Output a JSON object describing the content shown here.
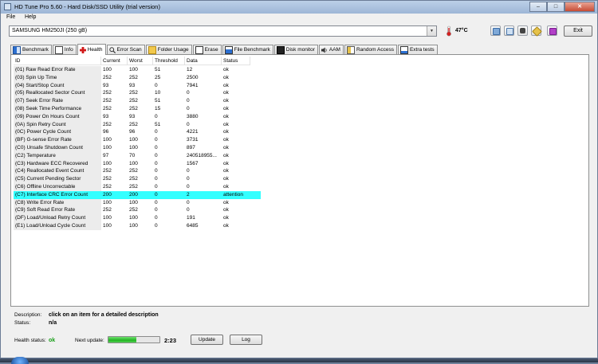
{
  "window": {
    "title": "HD Tune Pro 5.60 - Hard Disk/SSD Utility (trial version)"
  },
  "window_controls": {
    "minimize": "–",
    "maximize": "□",
    "close": "✕"
  },
  "menu": [
    "File",
    "Help"
  ],
  "toolbar": {
    "drive": "SAMSUNG HM250JI (250 gB)",
    "temperature": "47°C",
    "exit_label": "Exit",
    "icons": [
      "copy-info-icon",
      "copy-text-icon",
      "screenshot-icon",
      "options-icon",
      "save-icon"
    ]
  },
  "tabs": [
    {
      "label": "Benchmark",
      "icon": "benchmark-icon"
    },
    {
      "label": "Info",
      "icon": "info-icon"
    },
    {
      "label": "Health",
      "icon": "health-cross-icon"
    },
    {
      "label": "Error Scan",
      "icon": "error-scan-icon"
    },
    {
      "label": "Folder Usage",
      "icon": "folder-icon"
    },
    {
      "label": "Erase",
      "icon": "erase-icon"
    },
    {
      "label": "File Benchmark",
      "icon": "file-benchmark-icon"
    },
    {
      "label": "Disk monitor",
      "icon": "disk-monitor-icon"
    },
    {
      "label": "AAM",
      "icon": "speaker-icon"
    },
    {
      "label": "Random Access",
      "icon": "random-access-icon"
    },
    {
      "label": "Extra tests",
      "icon": "extra-tests-icon"
    }
  ],
  "active_tab": "Health",
  "table": {
    "columns": [
      "ID",
      "Current",
      "Worst",
      "Threshold",
      "Data",
      "Status"
    ],
    "rows": [
      [
        "(01) Raw Read Error Rate",
        "100",
        "100",
        "51",
        "12",
        "ok"
      ],
      [
        "(03) Spin Up Time",
        "252",
        "252",
        "25",
        "2500",
        "ok"
      ],
      [
        "(04) Start/Stop Count",
        "93",
        "93",
        "0",
        "7941",
        "ok"
      ],
      [
        "(05) Reallocated Sector Count",
        "252",
        "252",
        "10",
        "0",
        "ok"
      ],
      [
        "(07) Seek Error Rate",
        "252",
        "252",
        "51",
        "0",
        "ok"
      ],
      [
        "(08) Seek Time Performance",
        "252",
        "252",
        "15",
        "0",
        "ok"
      ],
      [
        "(09) Power On Hours Count",
        "93",
        "93",
        "0",
        "3880",
        "ok"
      ],
      [
        "(0A) Spin Retry Count",
        "252",
        "252",
        "51",
        "0",
        "ok"
      ],
      [
        "(0C) Power Cycle Count",
        "96",
        "96",
        "0",
        "4221",
        "ok"
      ],
      [
        "(BF) G-sense Error Rate",
        "100",
        "100",
        "0",
        "3731",
        "ok"
      ],
      [
        "(C0) Unsafe Shutdown Count",
        "100",
        "100",
        "0",
        "897",
        "ok"
      ],
      [
        "(C2) Temperature",
        "97",
        "70",
        "0",
        "240518955...",
        "ok"
      ],
      [
        "(C3) Hardware ECC Recovered",
        "100",
        "100",
        "0",
        "1567",
        "ok"
      ],
      [
        "(C4) Reallocated Event Count",
        "252",
        "252",
        "0",
        "0",
        "ok"
      ],
      [
        "(C5) Current Pending Sector",
        "252",
        "252",
        "0",
        "0",
        "ok"
      ],
      [
        "(C6) Offline Uncorrectable",
        "252",
        "252",
        "0",
        "0",
        "ok"
      ],
      [
        "(C7) Interface CRC Error Count",
        "200",
        "200",
        "0",
        "2",
        "attention"
      ],
      [
        "(C8) Write Error Rate",
        "100",
        "100",
        "0",
        "0",
        "ok"
      ],
      [
        "(C9) Soft Read Error Rate",
        "252",
        "252",
        "0",
        "0",
        "ok"
      ],
      [
        "(DF) Load/Unload Retry Count",
        "100",
        "100",
        "0",
        "191",
        "ok"
      ],
      [
        "(E1) Load/Unload Cycle Count",
        "100",
        "100",
        "0",
        "6485",
        "ok"
      ]
    ],
    "highlight_color": "#33ffff"
  },
  "details": {
    "description_label": "Description:",
    "description_value": "click on an item for a detailed description",
    "status_label": "Status:",
    "status_value": "n/a"
  },
  "footer": {
    "health_label": "Health status:",
    "health_value": "ok",
    "health_color": "#19a019",
    "next_update_label": "Next update:",
    "next_update_progress": 0.55,
    "next_update_time": "2:23",
    "update_label": "Update",
    "log_label": "Log"
  }
}
